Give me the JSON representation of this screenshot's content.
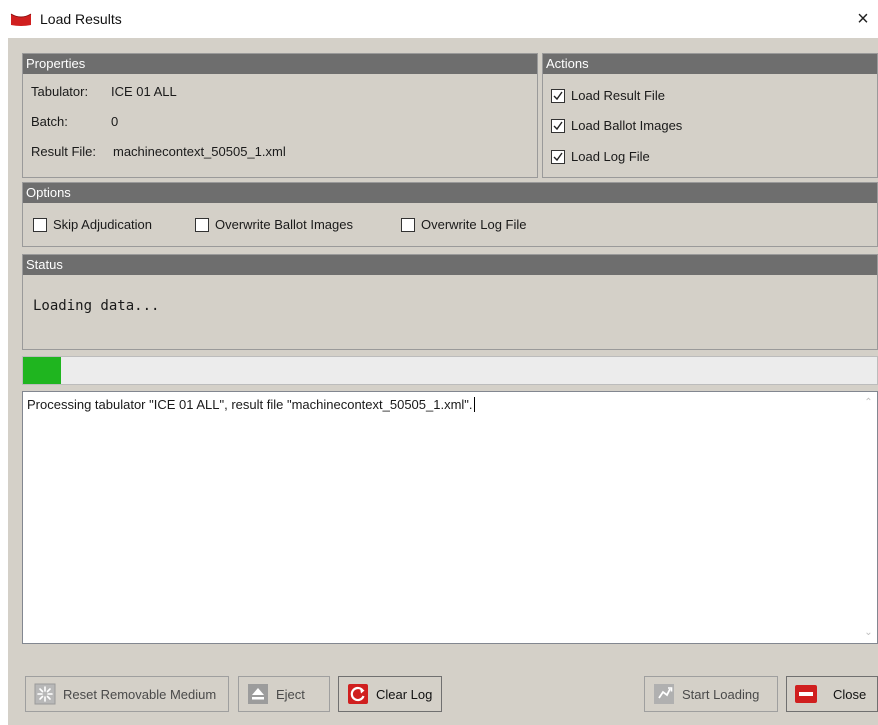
{
  "window": {
    "title": "Load Results",
    "close_glyph": "×",
    "app_icon": "red-ribbon-icon",
    "accent": "#d01f1f"
  },
  "properties": {
    "header": "Properties",
    "tabulator_label": "Tabulator:",
    "tabulator_value": "ICE 01 ALL",
    "batch_label": "Batch:",
    "batch_value": "0",
    "result_file_label": "Result File:",
    "result_file_value": "machinecontext_50505_1.xml"
  },
  "actions": {
    "header": "Actions",
    "items": [
      {
        "label": "Load Result File",
        "checked": true
      },
      {
        "label": "Load Ballot Images",
        "checked": true
      },
      {
        "label": "Load Log File",
        "checked": true
      }
    ]
  },
  "options": {
    "header": "Options",
    "items": [
      {
        "label": "Skip Adjudication",
        "checked": false
      },
      {
        "label": "Overwrite Ballot Images",
        "checked": false
      },
      {
        "label": "Overwrite Log File",
        "checked": false
      }
    ]
  },
  "status": {
    "header": "Status",
    "text": "Loading data..."
  },
  "progress": {
    "fraction": 0.045,
    "color": "#1fb51f"
  },
  "log": {
    "text": "Processing tabulator \"ICE 01 ALL\", result file \"machinecontext_50505_1.xml\"."
  },
  "buttons": {
    "reset": {
      "label": "Reset Removable Medium",
      "icon": "reset-medium-icon",
      "enabled": false
    },
    "eject": {
      "label": "Eject",
      "icon": "eject-icon",
      "enabled": false
    },
    "clear_log": {
      "label": "Clear Log",
      "icon": "refresh-icon",
      "enabled": true
    },
    "start_loading": {
      "label": "Start Loading",
      "icon": "start-loading-icon",
      "enabled": false
    },
    "close": {
      "label": "Close",
      "icon": "close-minus-icon",
      "enabled": true
    }
  }
}
